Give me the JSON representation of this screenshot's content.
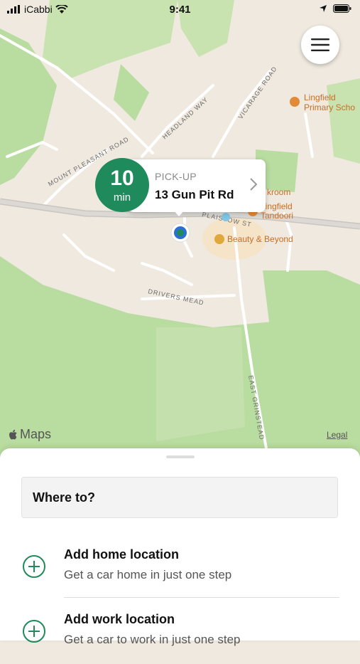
{
  "status_bar": {
    "carrier": "iCabbi",
    "time": "9:41"
  },
  "map": {
    "street_labels": [
      "MOUNT PLEASANT ROAD",
      "HEADLAND WAY",
      "VICARAGE ROAD",
      "DRIVERS MEAD",
      "EAST GRINSTEAD",
      "PLAISTOW ST"
    ],
    "poi_labels": [
      "Lingfield",
      "Primary Scho",
      "Beauty & Beyond",
      "Lingfield",
      "Tandoori",
      "kroom"
    ],
    "attribution": "Maps",
    "legal": "Legal"
  },
  "eta": {
    "value": "10",
    "unit": "min"
  },
  "pickup": {
    "caption": "PICK-UP",
    "address": "13 Gun Pit Rd"
  },
  "sheet": {
    "search_placeholder": "Where to?",
    "items": [
      {
        "title": "Add home location",
        "subtitle": "Get a car home in just one step"
      },
      {
        "title": "Add work location",
        "subtitle": "Get a car to work in just one step"
      }
    ]
  },
  "colors": {
    "accent": "#1f8a5b",
    "map_green": "#b9dca0",
    "poi_orange": "#e08a3a"
  },
  "icons": [
    "signal-icon",
    "wifi-icon",
    "location-arrow-icon",
    "battery-icon",
    "hamburger-menu-icon",
    "chevron-right-icon",
    "apple-logo-icon",
    "plus-circle-icon",
    "user-location-icon"
  ]
}
